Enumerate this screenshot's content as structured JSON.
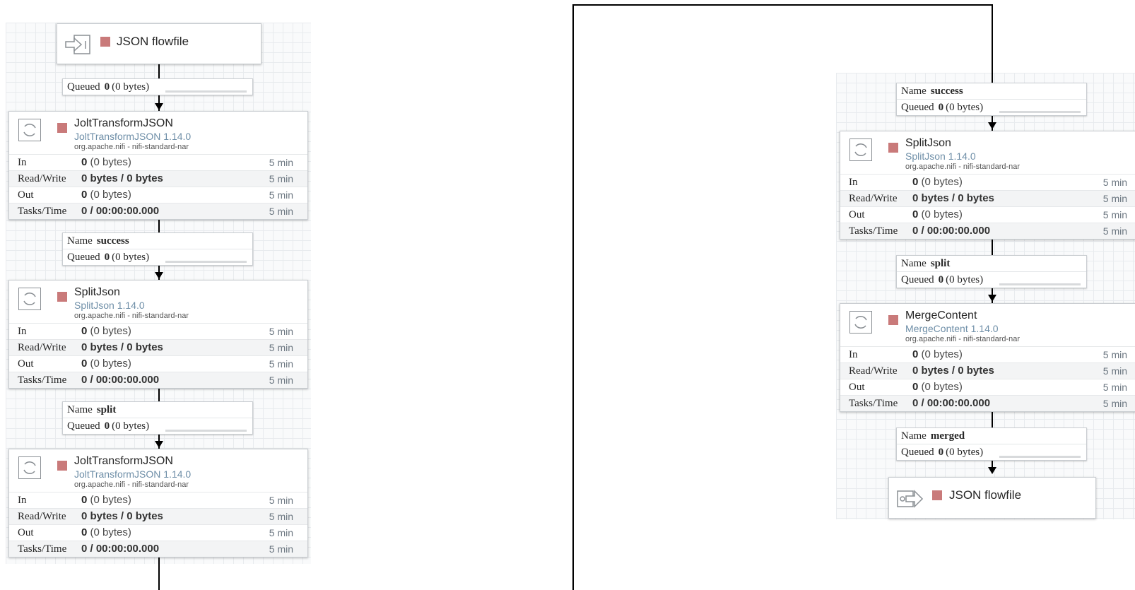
{
  "left_flow": {
    "input_port": {
      "name": "JSON flowfile"
    },
    "conn1": {
      "queued_label": "Queued",
      "queued_value": "0",
      "queued_bytes": "(0 bytes)"
    },
    "proc1": {
      "name": "JoltTransformJSON",
      "type": "JoltTransformJSON 1.14.0",
      "bundle": "org.apache.nifi - nifi-standard-nar",
      "in_label": "In",
      "in_value": "0",
      "in_bytes": "(0 bytes)",
      "in_time": "5 min",
      "rw_label": "Read/Write",
      "rw_value": "0 bytes / 0 bytes",
      "rw_time": "5 min",
      "out_label": "Out",
      "out_value": "0",
      "out_bytes": "(0 bytes)",
      "out_time": "5 min",
      "tasks_label": "Tasks/Time",
      "tasks_value": "0 / 00:00:00.000",
      "tasks_time": "5 min"
    },
    "conn2": {
      "name_label": "Name",
      "name_value": "success",
      "queued_label": "Queued",
      "queued_value": "0",
      "queued_bytes": "(0 bytes)"
    },
    "proc2": {
      "name": "SplitJson",
      "type": "SplitJson 1.14.0",
      "bundle": "org.apache.nifi - nifi-standard-nar",
      "in_label": "In",
      "in_value": "0",
      "in_bytes": "(0 bytes)",
      "in_time": "5 min",
      "rw_label": "Read/Write",
      "rw_value": "0 bytes / 0 bytes",
      "rw_time": "5 min",
      "out_label": "Out",
      "out_value": "0",
      "out_bytes": "(0 bytes)",
      "out_time": "5 min",
      "tasks_label": "Tasks/Time",
      "tasks_value": "0 / 00:00:00.000",
      "tasks_time": "5 min"
    },
    "conn3": {
      "name_label": "Name",
      "name_value": "split",
      "queued_label": "Queued",
      "queued_value": "0",
      "queued_bytes": "(0 bytes)"
    },
    "proc3": {
      "name": "JoltTransformJSON",
      "type": "JoltTransformJSON 1.14.0",
      "bundle": "org.apache.nifi - nifi-standard-nar",
      "in_label": "In",
      "in_value": "0",
      "in_bytes": "(0 bytes)",
      "in_time": "5 min",
      "rw_label": "Read/Write",
      "rw_value": "0 bytes / 0 bytes",
      "rw_time": "5 min",
      "out_label": "Out",
      "out_value": "0",
      "out_bytes": "(0 bytes)",
      "out_time": "5 min",
      "tasks_label": "Tasks/Time",
      "tasks_value": "0 / 00:00:00.000",
      "tasks_time": "5 min"
    }
  },
  "right_flow": {
    "conn1": {
      "name_label": "Name",
      "name_value": "success",
      "queued_label": "Queued",
      "queued_value": "0",
      "queued_bytes": "(0 bytes)"
    },
    "proc1": {
      "name": "SplitJson",
      "type": "SplitJson 1.14.0",
      "bundle": "org.apache.nifi - nifi-standard-nar",
      "in_label": "In",
      "in_value": "0",
      "in_bytes": "(0 bytes)",
      "in_time": "5 min",
      "rw_label": "Read/Write",
      "rw_value": "0 bytes / 0 bytes",
      "rw_time": "5 min",
      "out_label": "Out",
      "out_value": "0",
      "out_bytes": "(0 bytes)",
      "out_time": "5 min",
      "tasks_label": "Tasks/Time",
      "tasks_value": "0 / 00:00:00.000",
      "tasks_time": "5 min"
    },
    "conn2": {
      "name_label": "Name",
      "name_value": "split",
      "queued_label": "Queued",
      "queued_value": "0",
      "queued_bytes": "(0 bytes)"
    },
    "proc2": {
      "name": "MergeContent",
      "type": "MergeContent 1.14.0",
      "bundle": "org.apache.nifi - nifi-standard-nar",
      "in_label": "In",
      "in_value": "0",
      "in_bytes": "(0 bytes)",
      "in_time": "5 min",
      "rw_label": "Read/Write",
      "rw_value": "0 bytes / 0 bytes",
      "rw_time": "5 min",
      "out_label": "Out",
      "out_value": "0",
      "out_bytes": "(0 bytes)",
      "out_time": "5 min",
      "tasks_label": "Tasks/Time",
      "tasks_value": "0 / 00:00:00.000",
      "tasks_time": "5 min"
    },
    "conn3": {
      "name_label": "Name",
      "name_value": "merged",
      "queued_label": "Queued",
      "queued_value": "0",
      "queued_bytes": "(0 bytes)"
    },
    "output_port": {
      "name": "JSON flowfile"
    }
  },
  "colors": {
    "stopped": "#c97a7a",
    "type_text": "#6f8fa8",
    "grid": "#e8ebee"
  }
}
